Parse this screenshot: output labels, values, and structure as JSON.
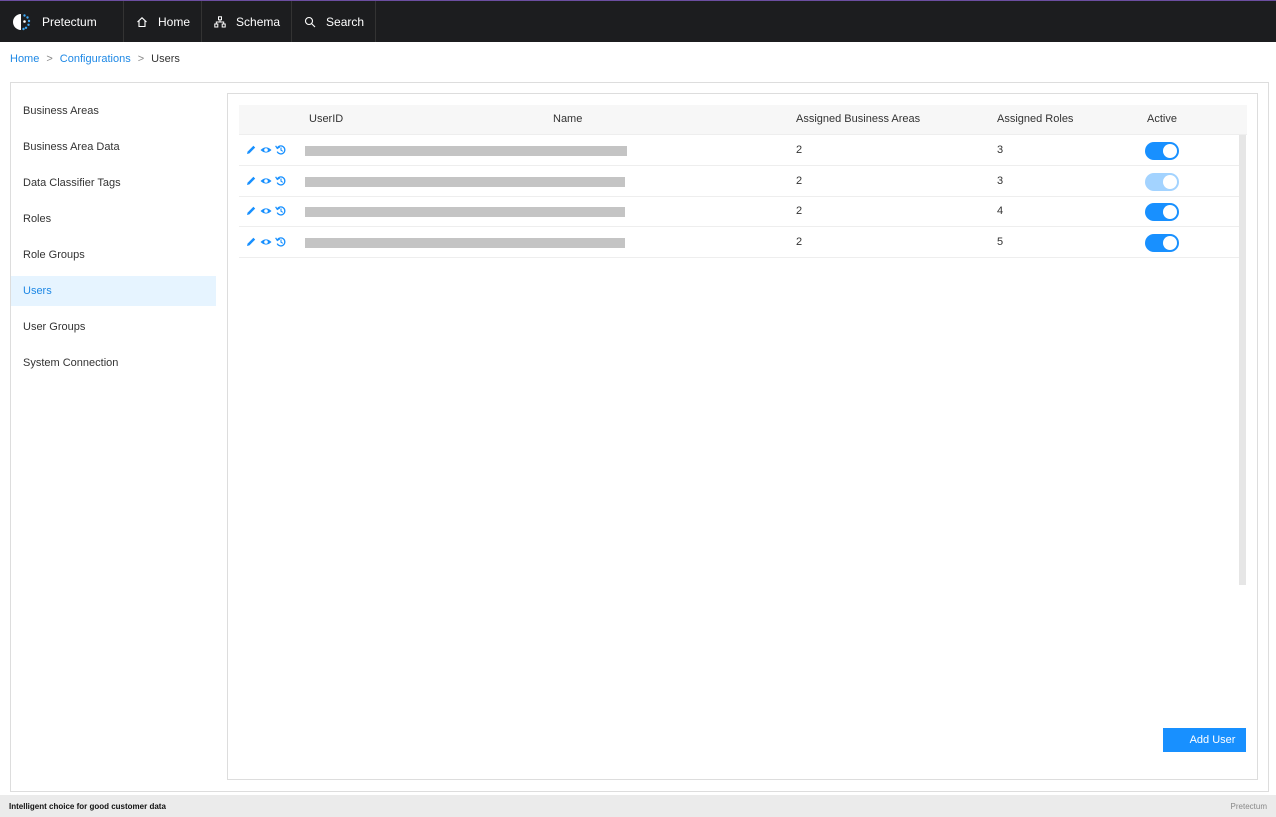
{
  "header": {
    "brand": "Pretectum",
    "nav": [
      {
        "label": "Home",
        "icon": "home-icon"
      },
      {
        "label": "Schema",
        "icon": "schema-icon"
      },
      {
        "label": "Search",
        "icon": "search-icon"
      }
    ]
  },
  "breadcrumb": {
    "home": "Home",
    "configurations": "Configurations",
    "current": "Users",
    "separator": ">"
  },
  "sidebar": {
    "items": [
      {
        "label": "Business Areas"
      },
      {
        "label": "Business Area Data"
      },
      {
        "label": "Data Classifier Tags"
      },
      {
        "label": "Roles"
      },
      {
        "label": "Role Groups"
      },
      {
        "label": "Users",
        "active": true
      },
      {
        "label": "User Groups"
      },
      {
        "label": "System Connection"
      }
    ]
  },
  "table": {
    "columns": {
      "userid": "UserID",
      "name": "Name",
      "business_areas": "Assigned Business Areas",
      "roles": "Assigned Roles",
      "active": "Active"
    },
    "rows": [
      {
        "business_areas": "2",
        "roles": "3",
        "active": true,
        "disabled": false
      },
      {
        "business_areas": "2",
        "roles": "3",
        "active": true,
        "disabled": true
      },
      {
        "business_areas": "2",
        "roles": "4",
        "active": true,
        "disabled": false
      },
      {
        "business_areas": "2",
        "roles": "5",
        "active": true,
        "disabled": false
      }
    ]
  },
  "add_user_label": "Add User",
  "footer": {
    "tagline": "Intelligent choice for good customer data",
    "brand": "Pretectum"
  },
  "colors": {
    "accent": "#1890ff",
    "topbar": "#1c1d1f",
    "toggle_disabled": "#a3d3ff"
  }
}
